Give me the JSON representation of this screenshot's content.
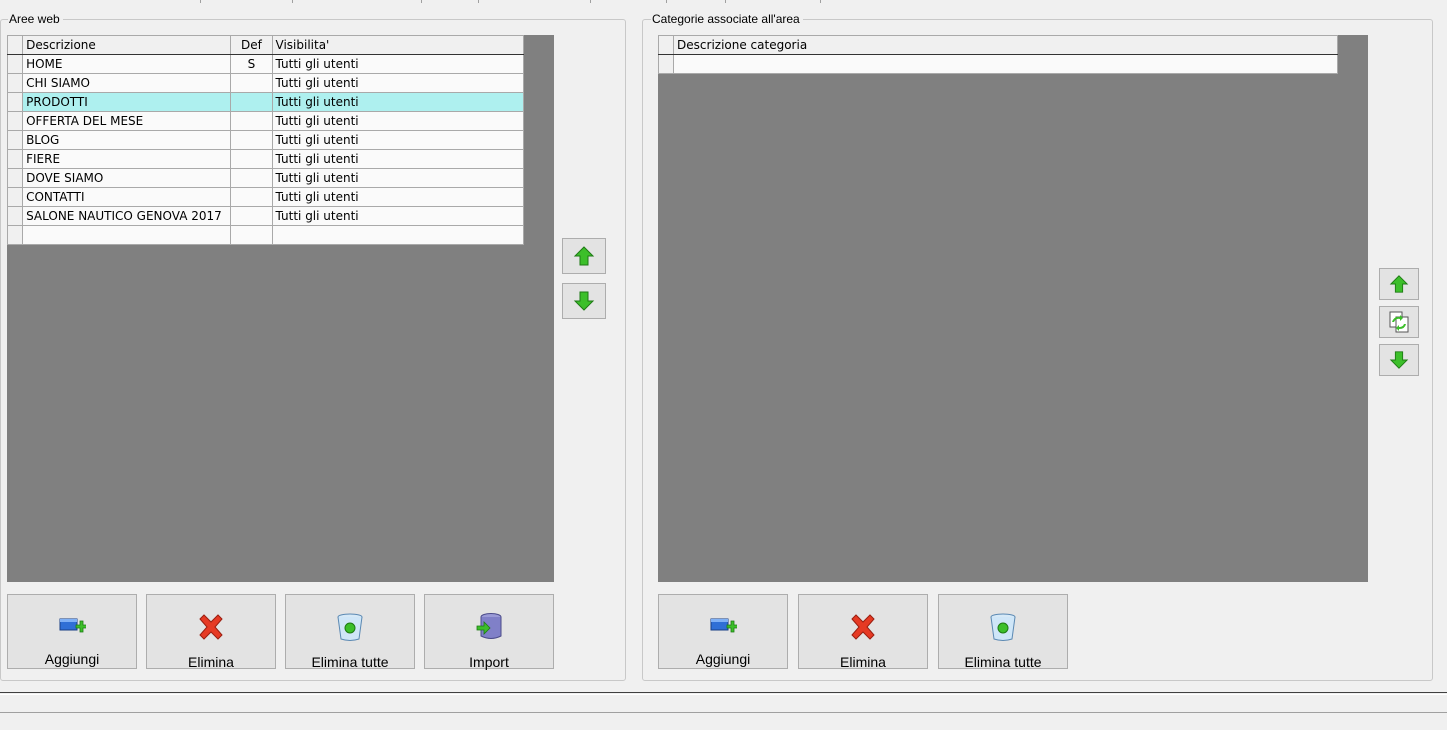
{
  "left_panel": {
    "title": "Aree web",
    "columns": {
      "descrizione": "Descrizione",
      "def": "Def",
      "visibilita": "Visibilita'"
    },
    "rows": [
      {
        "descrizione": "HOME",
        "def": "S",
        "visibilita": "Tutti gli utenti"
      },
      {
        "descrizione": "CHI SIAMO",
        "def": "",
        "visibilita": "Tutti gli utenti"
      },
      {
        "descrizione": "PRODOTTI",
        "def": "",
        "visibilita": "Tutti gli utenti",
        "selected": true
      },
      {
        "descrizione": "OFFERTA DEL MESE",
        "def": "",
        "visibilita": "Tutti gli utenti"
      },
      {
        "descrizione": "BLOG",
        "def": "",
        "visibilita": "Tutti gli utenti"
      },
      {
        "descrizione": "FIERE",
        "def": "",
        "visibilita": "Tutti gli utenti"
      },
      {
        "descrizione": "DOVE SIAMO",
        "def": "",
        "visibilita": "Tutti gli utenti"
      },
      {
        "descrizione": "CONTATTI",
        "def": "",
        "visibilita": "Tutti gli utenti"
      },
      {
        "descrizione": "SALONE NAUTICO GENOVA 2017",
        "def": "",
        "visibilita": "Tutti gli utenti"
      },
      {
        "descrizione": "",
        "def": "",
        "visibilita": ""
      }
    ],
    "buttons": {
      "aggiungi": "Aggiungi",
      "elimina": "Elimina",
      "elimina_tutte": "Elimina tutte",
      "import": "Import"
    }
  },
  "right_panel": {
    "title": "Categorie associate all'area",
    "columns": {
      "descrizione": "Descrizione categoria"
    },
    "rows": [
      {
        "descrizione": ""
      }
    ],
    "buttons": {
      "aggiungi": "Aggiungi",
      "elimina": "Elimina",
      "elimina_tutte": "Elimina tutte"
    }
  },
  "colors": {
    "selected_row": "#aef0ef",
    "grid_background": "#808080",
    "arrow_green": "#3cbf2a",
    "delete_red": "#e63a24"
  },
  "icons": {
    "add": "add-icon",
    "delete": "delete-x-icon",
    "delete_all": "recycle-bin-icon",
    "import": "database-import-icon",
    "up": "arrow-up-icon",
    "down": "arrow-down-icon",
    "swap": "swap-pages-icon"
  }
}
